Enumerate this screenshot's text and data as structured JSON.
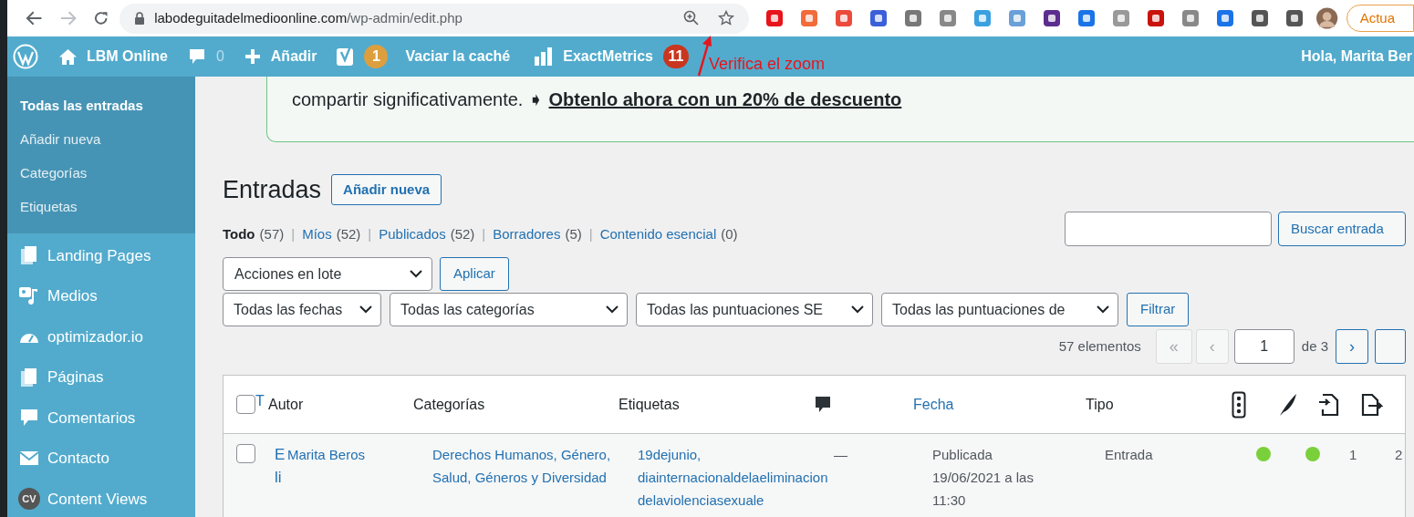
{
  "browser": {
    "url_domain": "labodeguitadelmedioonline.com",
    "url_path": "/wp-admin/edit.php",
    "profile_button": "Actua"
  },
  "annotation": {
    "text": "Verifica el zoom"
  },
  "admin_bar": {
    "site": "LBM Online",
    "comments": "0",
    "add": "Añadir",
    "yoast_badge": "1",
    "cache": "Vaciar la caché",
    "metrics": "ExactMetrics",
    "metrics_badge": "11",
    "greeting": "Hola, Marita Ber"
  },
  "submenu": [
    {
      "label": "Todas las entradas",
      "selected": true
    },
    {
      "label": "Añadir nueva",
      "selected": false
    },
    {
      "label": "Categorías",
      "selected": false
    },
    {
      "label": "Etiquetas",
      "selected": false
    }
  ],
  "menu": [
    {
      "label": "Landing Pages",
      "kind": "pages"
    },
    {
      "label": "Medios",
      "kind": "media"
    },
    {
      "label": "optimizador.io",
      "kind": "gauge"
    },
    {
      "label": "Páginas",
      "kind": "pages"
    },
    {
      "label": "Comentarios",
      "kind": "comment"
    },
    {
      "label": "Contacto",
      "kind": "mail"
    },
    {
      "label": "Content Views",
      "kind": "badge",
      "badge": "CV"
    }
  ],
  "notice": {
    "text": "compartir significativamente. ➧",
    "link": "Obtenlo ahora con un 20% de descuento"
  },
  "page": {
    "title": "Entradas",
    "add_button": "Añadir nueva"
  },
  "views": [
    {
      "label": "Todo",
      "count": "(57)",
      "selected": true
    },
    {
      "separator": "|",
      "label": "Míos",
      "count": "(52)",
      "selected": false
    },
    {
      "separator": "|",
      "label": "Publicados",
      "count": "(52)",
      "selected": false
    },
    {
      "separator": "|",
      "label": "Borradores",
      "count": "(5)",
      "selected": false
    },
    {
      "separator": "|",
      "label": "Contenido esencial",
      "count": "(0)",
      "selected": false
    }
  ],
  "search": {
    "button": "Buscar entrada"
  },
  "bulk": {
    "select": "Acciones en lote",
    "button": "Aplicar"
  },
  "filters": [
    {
      "label": "Todas las fechas"
    },
    {
      "label": "Todas las categorías"
    },
    {
      "label": "Todas las puntuaciones SE"
    },
    {
      "label": "Todas las puntuaciones de"
    }
  ],
  "filter_button": "Filtrar",
  "pagination": {
    "count": "57 elementos",
    "first": "«",
    "prev": "‹",
    "page": "1",
    "of": "de 3",
    "next": "›"
  },
  "table": {
    "select_all_checked": false,
    "columns": [
      {
        "kind": "text",
        "label": "T",
        "sortable": true
      },
      {
        "kind": "text",
        "label": "Autor",
        "sortable": false
      },
      {
        "kind": "text",
        "label": "Categorías",
        "sortable": false
      },
      {
        "kind": "text",
        "label": "Etiquetas",
        "sortable": false
      },
      {
        "kind": "comments"
      },
      {
        "kind": "text",
        "label": "Fecha",
        "sortable": true
      },
      {
        "kind": "text",
        "label": "Tipo",
        "sortable": false
      },
      {
        "kind": "seo"
      },
      {
        "kind": "readability"
      },
      {
        "kind": "incoming"
      },
      {
        "kind": "outgoing"
      }
    ],
    "rows": [
      {
        "checked": false,
        "title": "Eli",
        "author": "Marita Beros",
        "categories": "Derechos Humanos, Género, Salud, Géneros y Diversidad",
        "tags": "19dejunio, diainternacionaldelaeliminaciondelaviolenciasexuale",
        "comments": "—",
        "status": "Publicada",
        "date": "19/06/2021 a las 11:30",
        "type": "Entrada",
        "seo": {
          "color": "#7ad03a"
        },
        "readability": {
          "color": "#7ad03a"
        },
        "links_in": "1",
        "links_out": "2"
      }
    ]
  }
}
